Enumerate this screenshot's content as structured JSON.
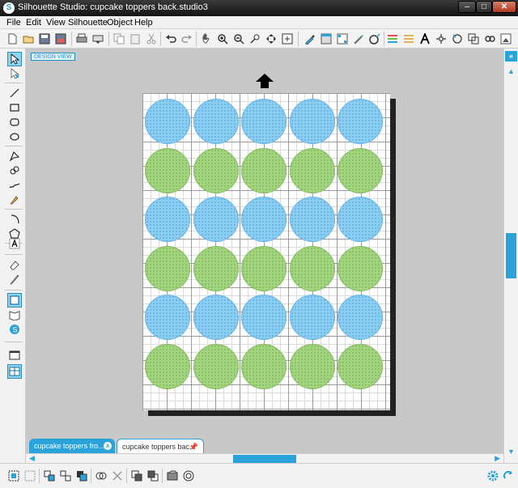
{
  "window": {
    "title": "Silhouette Studio: cupcake toppers back.studio3",
    "app_icon": "S",
    "min_label": "–",
    "max_label": "□",
    "close_label": "✕"
  },
  "menu": [
    {
      "id": "file",
      "label": "File"
    },
    {
      "id": "edit",
      "label": "Edit"
    },
    {
      "id": "view",
      "label": "View"
    },
    {
      "id": "silhouette",
      "label": "Silhouette"
    },
    {
      "id": "object",
      "label": "Object"
    },
    {
      "id": "help",
      "label": "Help"
    }
  ],
  "toolbar": [
    {
      "icon": "new-document-icon"
    },
    {
      "icon": "open-folder-icon"
    },
    {
      "icon": "save-icon"
    },
    {
      "icon": "save-to-library-icon"
    },
    {
      "icon": "print-icon"
    },
    {
      "icon": "send-to-silhouette-icon"
    },
    {
      "icon": "copy-icon"
    },
    {
      "icon": "paste-icon"
    },
    {
      "icon": "cut-icon"
    },
    {
      "icon": "undo-icon"
    },
    {
      "icon": "redo-icon"
    },
    {
      "icon": "pan-hand-icon"
    },
    {
      "icon": "zoom-in-icon"
    },
    {
      "icon": "zoom-out-icon"
    },
    {
      "icon": "zoom-drag-icon"
    },
    {
      "icon": "zoom-fit-page-icon"
    },
    {
      "icon": "zoom-selected-icon"
    },
    {
      "icon": "grid-settings-icon"
    },
    {
      "icon": "page-setup-icon"
    },
    {
      "icon": "registration-marks-icon"
    },
    {
      "icon": "cut-settings-icon"
    },
    {
      "icon": "trace-icon"
    },
    {
      "icon": "fill-color-icon"
    },
    {
      "icon": "line-color-icon"
    },
    {
      "icon": "line-style-icon"
    },
    {
      "icon": "text-style-icon"
    },
    {
      "icon": "transform-icon"
    },
    {
      "icon": "replicate-icon"
    },
    {
      "icon": "modify-icon"
    },
    {
      "icon": "offset-icon"
    },
    {
      "icon": "library-icon"
    }
  ],
  "tools": [
    {
      "icon": "select-arrow-icon",
      "selected": true
    },
    {
      "icon": "edit-points-icon"
    },
    {
      "icon": "line-tool-icon"
    },
    {
      "icon": "rectangle-tool-icon"
    },
    {
      "icon": "rounded-rectangle-tool-icon"
    },
    {
      "icon": "ellipse-tool-icon"
    },
    {
      "icon": "polygon-tool-icon"
    },
    {
      "icon": "curve-tool-icon"
    },
    {
      "icon": "freehand-tool-icon"
    },
    {
      "icon": "smooth-freehand-tool-icon"
    },
    {
      "icon": "arc-tool-icon"
    },
    {
      "icon": "regular-polygon-tool-icon"
    },
    {
      "icon": "text-tool-icon"
    },
    {
      "icon": "eraser-tool-icon"
    },
    {
      "icon": "knife-tool-icon"
    },
    {
      "icon": "design-page-icon",
      "selected": true
    },
    {
      "icon": "library-view-icon"
    },
    {
      "icon": "store-icon"
    },
    {
      "icon": "single-view-icon"
    },
    {
      "icon": "split-view-icon",
      "selected": true
    }
  ],
  "workspace": {
    "design_view_label": "DESIGN VIEW",
    "row_colors": [
      "blue",
      "green",
      "blue",
      "green",
      "blue",
      "green"
    ],
    "columns": 5,
    "colors": {
      "blue": "#8ccdf2",
      "blue_dot": "#64b4e6",
      "green": "#a3d47f",
      "green_dot": "#84bd5f"
    }
  },
  "tabs": [
    {
      "label": "cupcake toppers fro...",
      "active": true,
      "control": "x"
    },
    {
      "label": "cupcake toppers bac...",
      "active": false,
      "control": "📌"
    }
  ],
  "right_panel": {
    "collapse_label": "«",
    "up_arrow": "▲",
    "down_arrow": "▼"
  },
  "hscroll": {
    "left_arrow": "◀",
    "right_arrow": "▶"
  },
  "bottom_toolbar": [
    {
      "icon": "select-all-icon"
    },
    {
      "icon": "deselect-icon"
    },
    {
      "icon": "group-icon"
    },
    {
      "icon": "ungroup-icon"
    },
    {
      "icon": "compound-path-icon"
    },
    {
      "icon": "duplicate-icon"
    },
    {
      "icon": "delete-icon"
    },
    {
      "icon": "bring-to-front-icon"
    },
    {
      "icon": "send-to-back-icon"
    },
    {
      "icon": "fill-background-icon"
    },
    {
      "icon": "weld-icon"
    }
  ],
  "bottom_right": [
    {
      "icon": "settings-gear-icon"
    },
    {
      "icon": "refresh-icon"
    }
  ]
}
